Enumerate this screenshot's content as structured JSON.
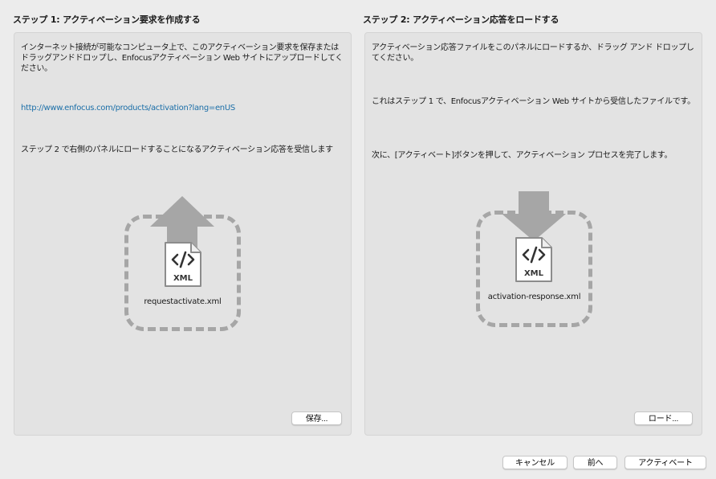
{
  "step1": {
    "title": "ステップ 1: アクティベーション要求を作成する",
    "paragraph1": "インターネット接続が可能なコンピュータ上で、このアクティベーション要求を保存またはドラッグアンドドロップし、Enfocusアクティベーション Web サイトにアップロードしてください。",
    "link": "http://www.enfocus.com/products/activation?lang=enUS",
    "paragraph2": "ステップ 2 で右側のパネルにロードすることになるアクティベーション応答を受信します",
    "file_type": "XML",
    "file_name": "requestactivate.xml",
    "file_icon": "xml-file-icon",
    "arrow_icon": "upload-arrow-icon",
    "save_button": "保存..."
  },
  "step2": {
    "title": "ステップ 2: アクティベーション応答をロードする",
    "paragraph1": "アクティベーション応答ファイルをこのパネルにロードするか、ドラッグ アンド ドロップしてください。",
    "paragraph2": "これはステップ 1 で、Enfocusアクティベーション Web サイトから受信したファイルです。",
    "paragraph3": "次に、[アクティベート]ボタンを押して、アクティベーション プロセスを完了します。",
    "file_type": "XML",
    "file_name": "activation-response.xml",
    "file_icon": "xml-file-icon",
    "arrow_icon": "download-arrow-icon",
    "load_button": "ロード..."
  },
  "footer": {
    "cancel_button": "キャンセル",
    "back_button": "前へ",
    "activate_button": "アクティベート"
  },
  "colors": {
    "link": "#1c6fa8",
    "panel_bg": "#e3e3e3",
    "window_bg": "#ececec",
    "dropzone_gray": "#a6a6a6"
  }
}
